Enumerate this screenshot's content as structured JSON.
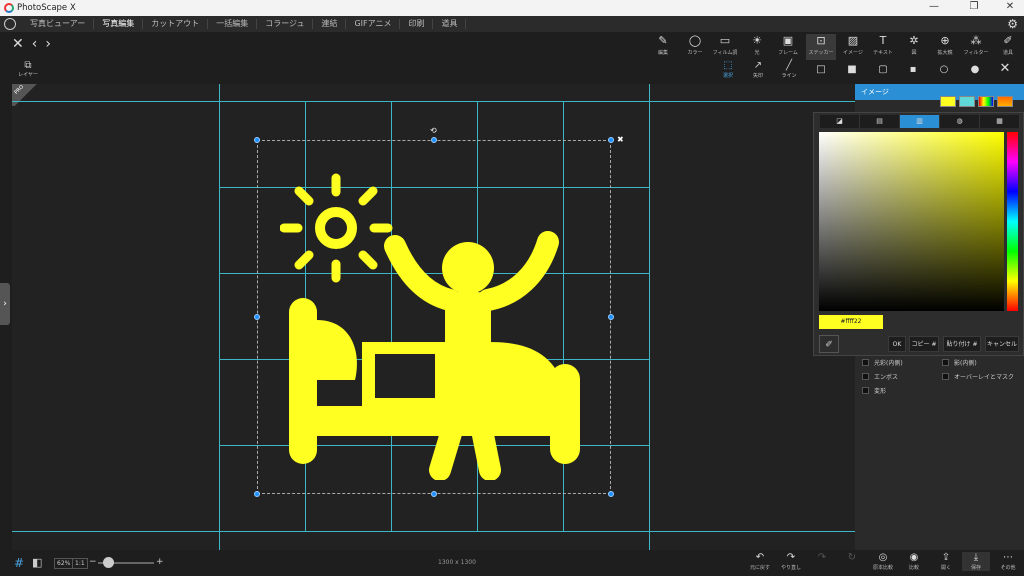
{
  "titlebar": {
    "title": "PhotoScape X",
    "minimize": "—",
    "maximize": "❐",
    "close": "✕"
  },
  "menu": {
    "items": [
      "写真ビューアー",
      "写真編集",
      "カットアウト",
      "一括編集",
      "コラージュ",
      "連結",
      "GIFアニメ",
      "印刷",
      "道具"
    ],
    "active_index": 1
  },
  "toolbar": {
    "items": [
      {
        "label": "編集",
        "icon": "edit-icon"
      },
      {
        "label": "カラー",
        "icon": "color-icon"
      },
      {
        "label": "フィルム調",
        "icon": "film-icon"
      },
      {
        "label": "光",
        "icon": "light-icon"
      },
      {
        "label": "フレーム",
        "icon": "frame-icon"
      },
      {
        "label": "ステッカー",
        "icon": "sticker-icon"
      },
      {
        "label": "イメージ",
        "icon": "image-icon"
      },
      {
        "label": "テキスト",
        "icon": "text-icon"
      },
      {
        "label": "図",
        "icon": "figure-icon"
      },
      {
        "label": "拡大鏡",
        "icon": "magnifier-icon"
      },
      {
        "label": "フィルター",
        "icon": "filter-icon"
      },
      {
        "label": "道具",
        "icon": "tool-icon"
      }
    ]
  },
  "subtools": [
    {
      "label": "選択"
    },
    {
      "label": "矢印"
    },
    {
      "label": "ライン"
    }
  ],
  "layer": {
    "label": "レイヤー"
  },
  "pro_badge": "PRO",
  "right_panel": {
    "header": "イメージ",
    "swatch_colors": [
      "#ffff22",
      "#60d8d8",
      "#ff6a00",
      "#ffb000"
    ],
    "picker_tabs": [
      "",
      "",
      "",
      "",
      ""
    ],
    "hex_value": "#ffff22",
    "buttons": {
      "ok": "OK",
      "copy": "コピー #",
      "paste": "貼り付け #",
      "cancel": "キャンセル"
    },
    "options": [
      {
        "label": "光彩(内側)"
      },
      {
        "label": "影(内側)"
      },
      {
        "label": "エンボス"
      },
      {
        "label": "オーバーレイとマスク"
      },
      {
        "label": "変形"
      }
    ]
  },
  "bottom": {
    "zoom_fit": "62%",
    "zoom_one": "1:1",
    "dimensions": "1300 x 1300",
    "buttons": [
      {
        "label": "元に戻す",
        "icon": "undo-icon"
      },
      {
        "label": "やり直し",
        "icon": "redo-icon"
      },
      {
        "label": "",
        "icon": "redo-all-icon"
      },
      {
        "label": "",
        "icon": "history-icon"
      },
      {
        "label": "原本比較",
        "icon": "compare-original-icon"
      },
      {
        "label": "比較",
        "icon": "compare-icon"
      },
      {
        "label": "開く",
        "icon": "open-icon"
      },
      {
        "label": "保存",
        "icon": "save-icon"
      },
      {
        "label": "その他",
        "icon": "more-icon"
      }
    ]
  },
  "colors": {
    "accent": "#2a8fd4",
    "artwork": "#ffff22",
    "guides": "#3fb6c6"
  }
}
